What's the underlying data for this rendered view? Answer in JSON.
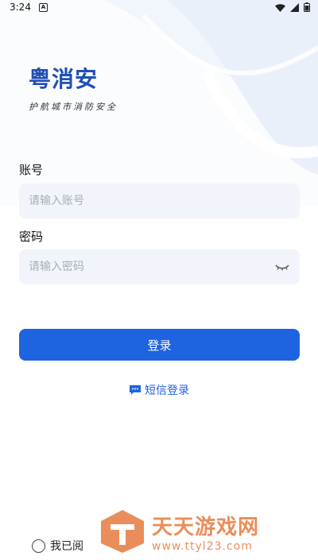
{
  "status_bar": {
    "time": "3:24",
    "notification_letter": "A"
  },
  "brand": {
    "title": "粤消安",
    "subtitle": "护航城市消防安全"
  },
  "account": {
    "label": "账号",
    "placeholder": "请输入账号",
    "value": ""
  },
  "password": {
    "label": "密码",
    "placeholder": "请输入密码",
    "value": ""
  },
  "login_button": "登录",
  "sms_login": "短信登录",
  "agreement": {
    "text": "我已阅"
  },
  "watermark": {
    "name": "天天游戏网",
    "url": "www.ttyl23.com"
  },
  "colors": {
    "primary": "#1e63e0",
    "brand": "#1f4fb5",
    "input_bg": "#f1f4fb",
    "watermark": "#e67b3e"
  }
}
